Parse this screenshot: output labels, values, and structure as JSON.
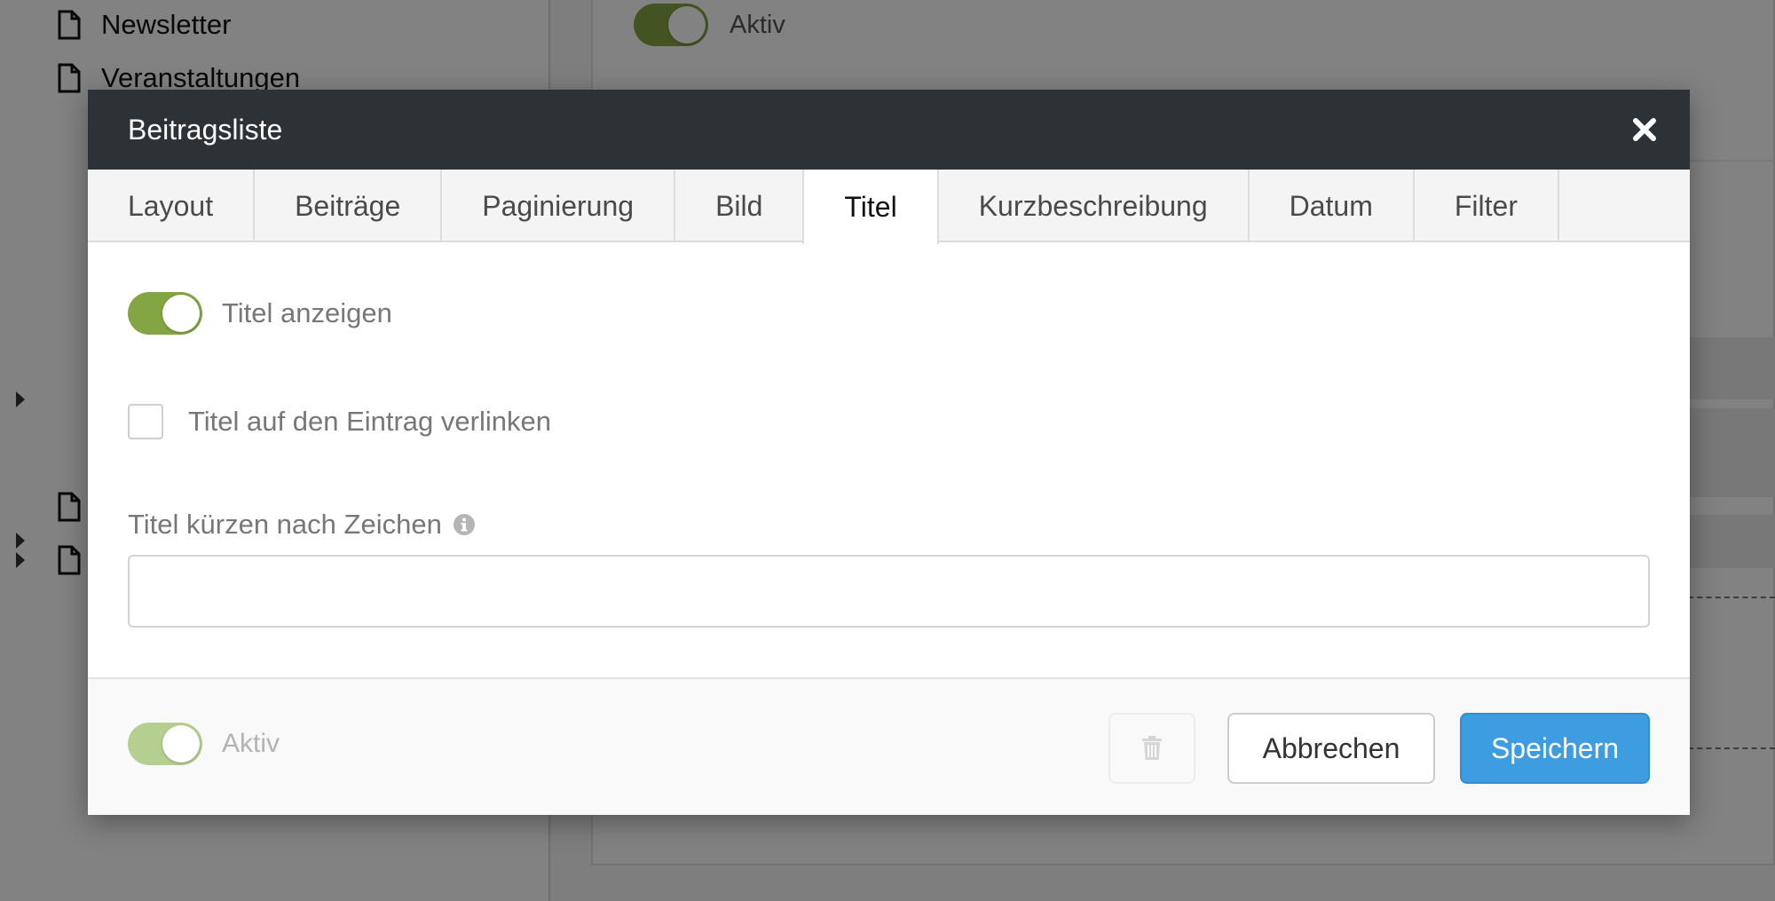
{
  "background": {
    "tree_items": [
      "Newsletter",
      "Veranstaltungen"
    ],
    "toggle_label": "Aktiv"
  },
  "modal": {
    "title": "Beitragsliste",
    "tabs": [
      {
        "label": "Layout",
        "active": false
      },
      {
        "label": "Beiträge",
        "active": false
      },
      {
        "label": "Paginierung",
        "active": false
      },
      {
        "label": "Bild",
        "active": false
      },
      {
        "label": "Titel",
        "active": true
      },
      {
        "label": "Kurzbeschreibung",
        "active": false
      },
      {
        "label": "Datum",
        "active": false
      },
      {
        "label": "Filter",
        "active": false
      }
    ],
    "show_title": {
      "label": "Titel anzeigen",
      "checked": true
    },
    "link_title": {
      "label": "Titel auf den Eintrag verlinken",
      "checked": false
    },
    "truncate": {
      "label": "Titel kürzen nach Zeichen",
      "value": "",
      "placeholder": ""
    },
    "footer": {
      "active_label": "Aktiv",
      "cancel_label": "Abbrechen",
      "save_label": "Speichern"
    }
  },
  "colors": {
    "header_bg": "#2d3236",
    "toggle_on": "#84a544",
    "primary": "#3d9de0"
  },
  "icons": [
    "file-icon",
    "close-icon",
    "info-icon",
    "trash-icon",
    "caret-right-icon"
  ]
}
